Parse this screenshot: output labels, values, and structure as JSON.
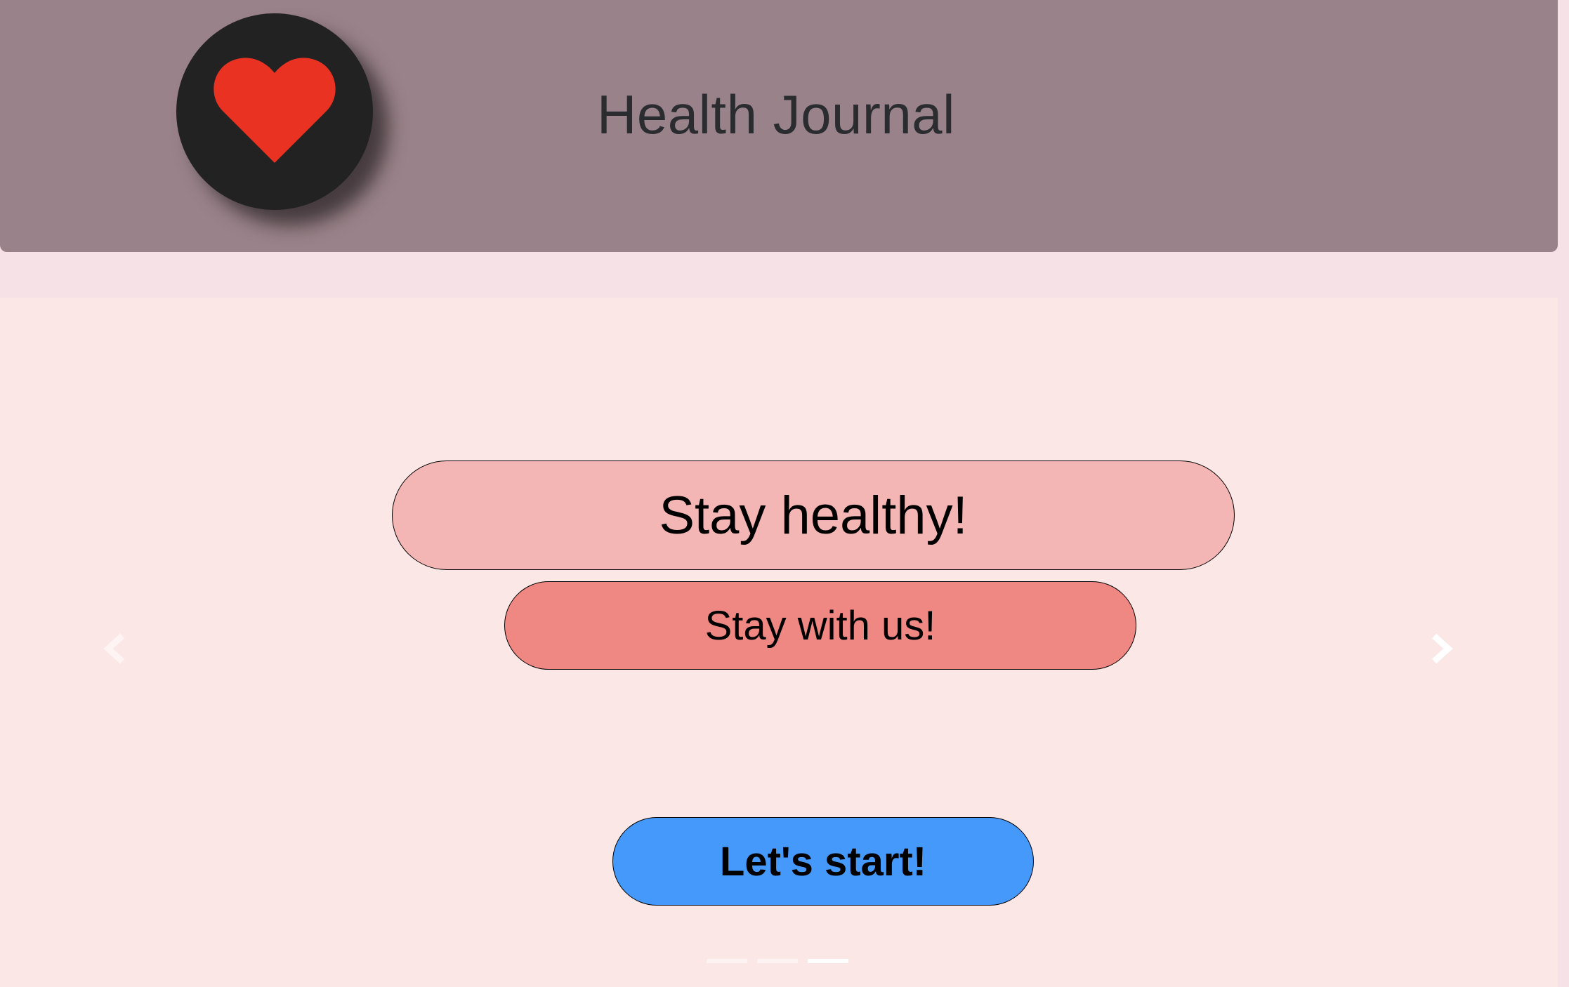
{
  "header": {
    "logo_icon": "heart-icon",
    "logo_color": "#e93222",
    "title": "Health Journal",
    "background": "#998289"
  },
  "carousel": {
    "slide": {
      "headline": "Stay healthy!",
      "subheadline": "Stay with us!"
    },
    "cta_label": "Let's start!",
    "prev_icon": "chevron-left-icon",
    "next_icon": "chevron-right-icon",
    "indicator_count": 3,
    "active_indicator": 3,
    "background": "#fbe7e6",
    "cta_color": "#4499fb"
  }
}
